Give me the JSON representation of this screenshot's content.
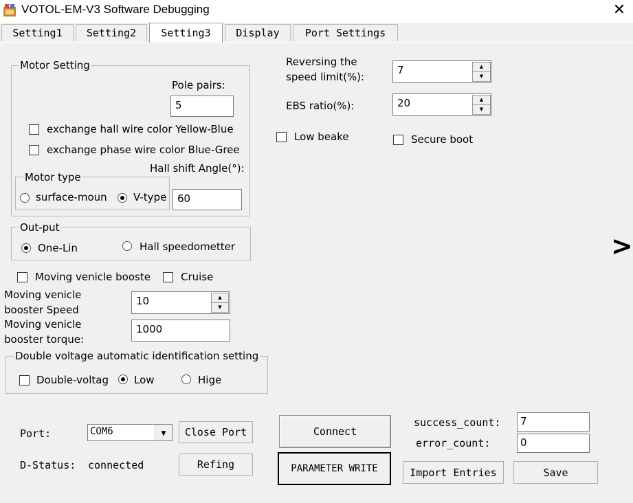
{
  "window": {
    "title": "VOTOL-EM-V3 Software Debugging",
    "close_glyph": "✕",
    "icon": "app-icon"
  },
  "tabs": [
    {
      "label": "Setting1",
      "active": false
    },
    {
      "label": "Setting2",
      "active": false
    },
    {
      "label": "Setting3",
      "active": true
    },
    {
      "label": "Display",
      "active": false
    },
    {
      "label": "Port Settings",
      "active": false
    }
  ],
  "motor_setting": {
    "legend": "Motor Setting",
    "pole_pairs_label": "Pole pairs:",
    "pole_pairs_value": "5",
    "exchange_hall_label": "exchange hall wire color Yellow-Blue",
    "exchange_hall_checked": false,
    "exchange_phase_label": "exchange phase wire color Blue-Gree",
    "exchange_phase_checked": false,
    "hall_shift_label": "Hall shift Angle(°):",
    "hall_shift_value": "60",
    "motor_type": {
      "legend": "Motor type",
      "options": [
        "surface-moun",
        "V-type"
      ],
      "selected": "V-type"
    }
  },
  "output": {
    "legend": "Out-put",
    "options": [
      "One-Lin",
      "Hall speedometter"
    ],
    "selected": "One-Lin"
  },
  "booster": {
    "moving_vehicle_booster_label": "Moving venicle booste",
    "moving_vehicle_booster_checked": false,
    "cruise_label": "Cruise",
    "cruise_checked": false,
    "speed_label_line1": "Moving venicle",
    "speed_label_line2": "booster Speed",
    "speed_value": "10",
    "torque_label_line1": "Moving venicle",
    "torque_label_line2": "booster torque:",
    "torque_value": "1000"
  },
  "double_voltage": {
    "legend": "Double voltage automatic identification setting",
    "checkbox_label": "Double-voltag",
    "checked": false,
    "options": [
      "Low",
      "Hige"
    ],
    "selected": "Low"
  },
  "right": {
    "reversing_label_line1": "Reversing the",
    "reversing_label_line2": "speed limit(%):",
    "reversing_value": "7",
    "ebs_label": "EBS ratio(%):",
    "ebs_value": "20",
    "low_beake_label": "Low beake",
    "low_beake_checked": false,
    "secure_boot_label": "Secure boot",
    "secure_boot_checked": false
  },
  "next_glyph": ">",
  "bottom": {
    "port_label": "Port:",
    "port_value": "COM6",
    "close_port_label": "Close Port",
    "connect_label": "Connect",
    "parameter_write_label": "PARAMETER WRITE",
    "dstatus_label": "D-Status:",
    "dstatus_value": "connected",
    "refing_label": "Refing",
    "success_count_label": "success_count:",
    "success_count_value": "7",
    "error_count_label": "error_count:",
    "error_count_value": "0",
    "import_entries_label": "Import Entries",
    "save_label": "Save"
  }
}
